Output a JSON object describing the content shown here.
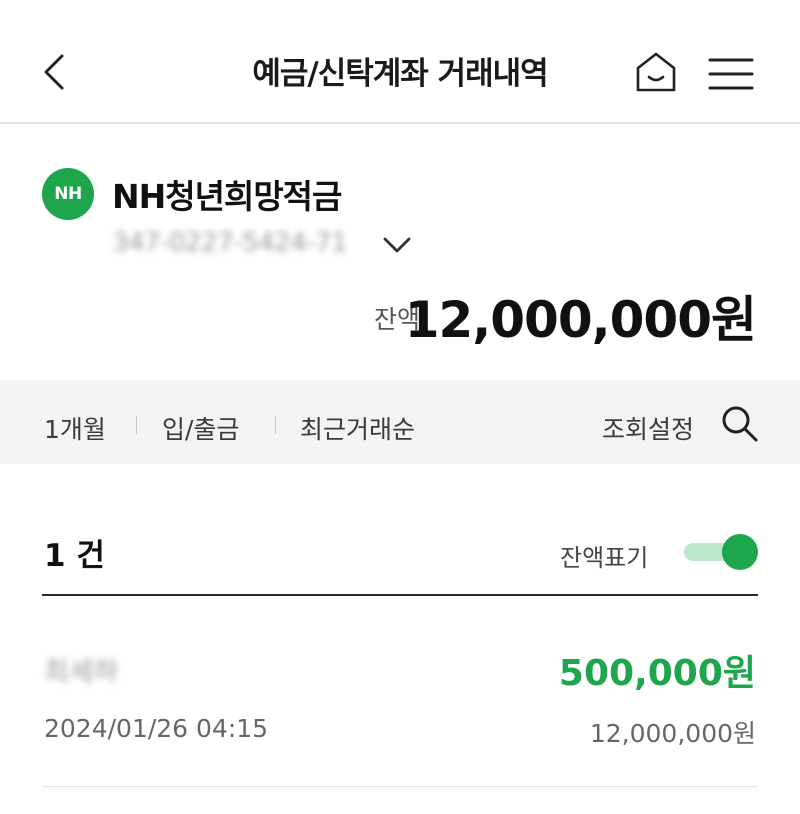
{
  "header": {
    "title": "예금/신탁계좌 거래내역",
    "back_icon": "chevron-left-icon",
    "home_icon": "home-icon",
    "menu_icon": "hamburger-menu-icon"
  },
  "account": {
    "logo_text": "NH",
    "name": "NH청년희망적금",
    "number": "347-0227-5424-71",
    "balance_label": "잔액",
    "balance": "12,000,000원"
  },
  "filter": {
    "period": "1개월",
    "type": "입/출금",
    "order": "최근거래순",
    "settings": "조회설정"
  },
  "list": {
    "count_label": "1 건",
    "toggle_label": "잔액표기",
    "toggle_on": true,
    "transactions": [
      {
        "name": "최세하",
        "amount": "500,000원",
        "date": "2024/01/26  04:15",
        "balance": "12,000,000원"
      }
    ]
  },
  "colors": {
    "brand_green": "#1ea64d",
    "filter_bg": "#f2f3f5"
  }
}
